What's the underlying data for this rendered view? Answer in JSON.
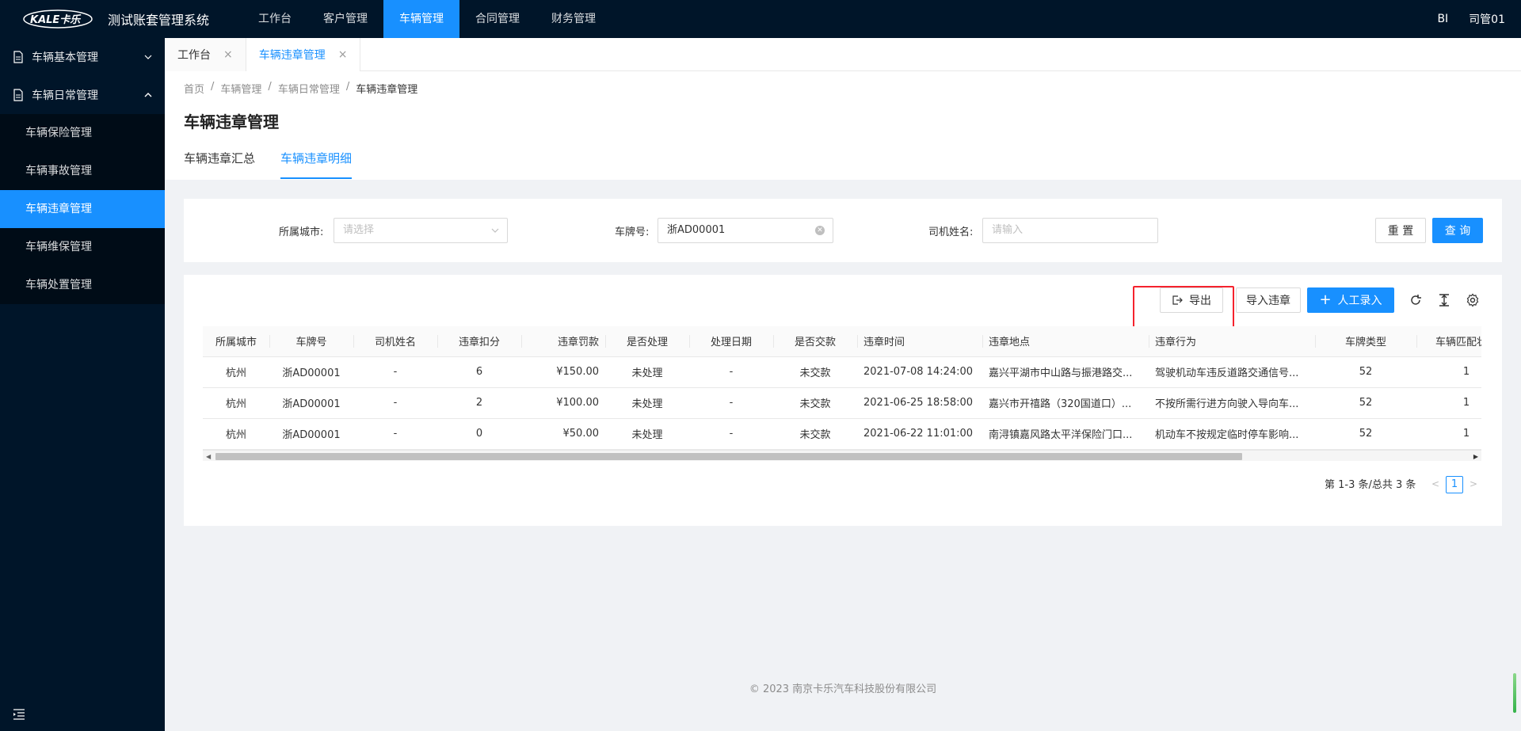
{
  "app": {
    "title": "测试账套管理系统",
    "logo_text": "KALE卡乐"
  },
  "topnav": {
    "items": [
      "工作台",
      "客户管理",
      "车辆管理",
      "合同管理",
      "财务管理"
    ],
    "right_bi": "BI",
    "user": "司管01"
  },
  "sidebar": {
    "group1": "车辆基本管理",
    "group2": "车辆日常管理",
    "items": [
      "车辆保险管理",
      "车辆事故管理",
      "车辆违章管理",
      "车辆维保管理",
      "车辆处置管理"
    ]
  },
  "tabs": {
    "t1": "工作台",
    "t2": "车辆违章管理",
    "close": "×"
  },
  "breadcrumb": {
    "b1": "首页",
    "b2": "车辆管理",
    "b3": "车辆日常管理",
    "b4": "车辆违章管理",
    "sep": "/"
  },
  "page": {
    "title": "车辆违章管理",
    "subtab1": "车辆违章汇总",
    "subtab2": "车辆违章明细"
  },
  "filters": {
    "city_label": "所属城市:",
    "city_placeholder": "请选择",
    "plate_label": "车牌号:",
    "plate_value": "浙AD00001",
    "driver_label": "司机姓名:",
    "driver_placeholder": "请输入",
    "reset": "重 置",
    "query": "查 询"
  },
  "toolbar": {
    "export": "导出",
    "import": "导入违章",
    "manual": "人工录入"
  },
  "table": {
    "headers": [
      "所属城市",
      "车牌号",
      "司机姓名",
      "违章扣分",
      "违章罚款",
      "是否处理",
      "处理日期",
      "是否交款",
      "违章时间",
      "违章地点",
      "违章行为",
      "车牌类型",
      "车辆匹配状态"
    ],
    "rows": [
      [
        "杭州",
        "浙AD00001",
        "-",
        "6",
        "¥150.00",
        "未处理",
        "-",
        "未交款",
        "2021-07-08 14:24:00",
        "嘉兴平湖市中山路与振港路交...",
        "驾驶机动车违反道路交通信号...",
        "52",
        "1"
      ],
      [
        "杭州",
        "浙AD00001",
        "-",
        "2",
        "¥100.00",
        "未处理",
        "-",
        "未交款",
        "2021-06-25 18:58:00",
        "嘉兴市开禧路（320国道口）...",
        "不按所需行进方向驶入导向车...",
        "52",
        "1"
      ],
      [
        "杭州",
        "浙AD00001",
        "-",
        "0",
        "¥50.00",
        "未处理",
        "-",
        "未交款",
        "2021-06-22 11:01:00",
        "南浔镇嘉风路太平洋保险门口...",
        "机动车不按规定临时停车影响...",
        "52",
        "1"
      ]
    ]
  },
  "pagination": {
    "summary": "第 1-3 条/总共 3 条",
    "current": "1",
    "prev": "<",
    "next": ">"
  },
  "footer": {
    "text": "© 2023 南京卡乐汽车科技股份有限公司"
  },
  "colors": {
    "primary": "#1890ff",
    "dark": "#001529",
    "highlight": "#f5222d"
  }
}
